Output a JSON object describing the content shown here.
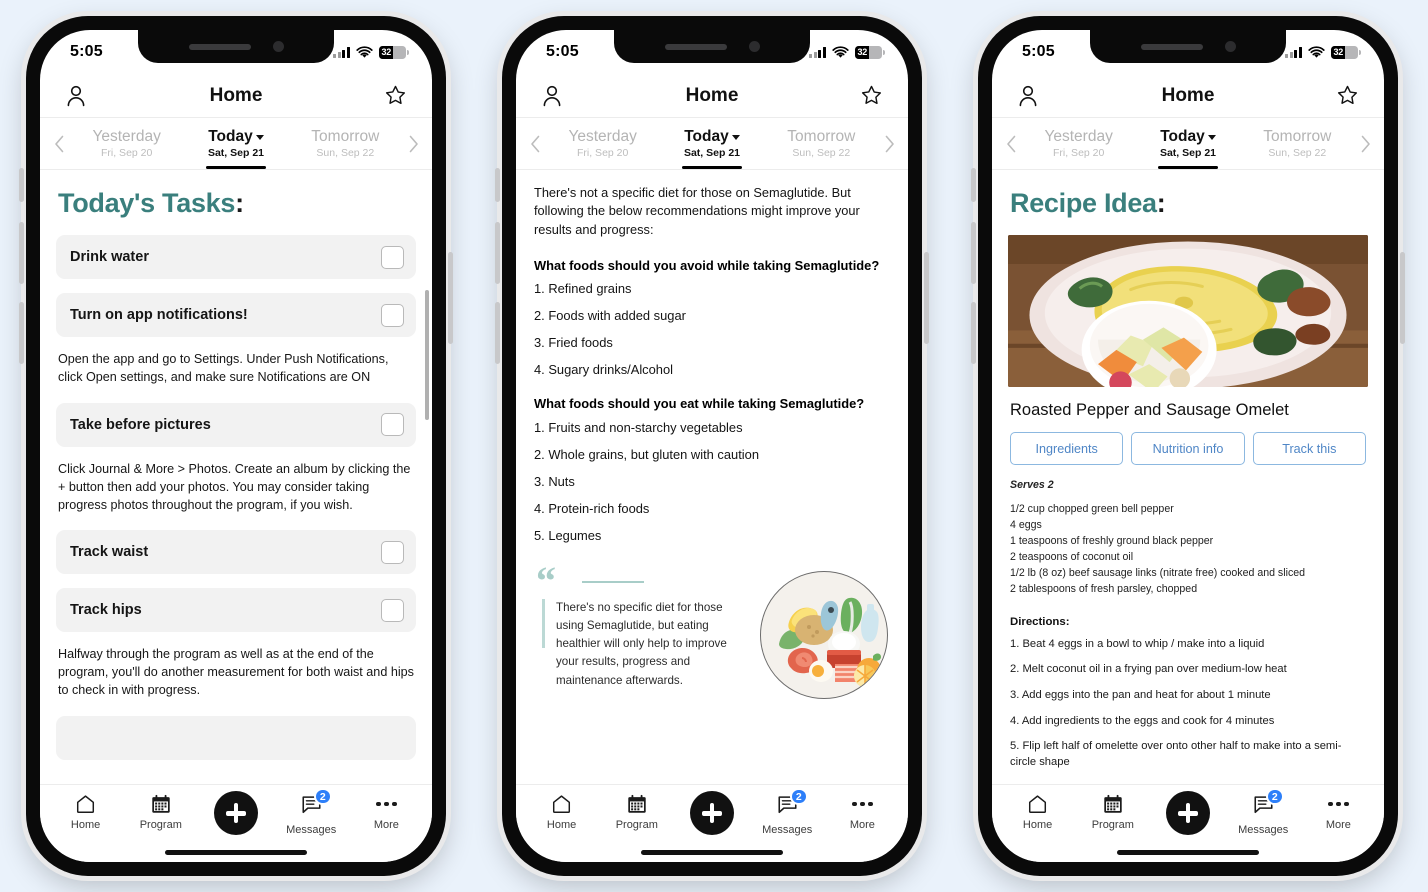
{
  "theme": {
    "accent_teal": "#3a7f7d",
    "pill_blue": "#4f86c6",
    "badge_blue": "#2d7ff9",
    "page_background": "#eaf2fb"
  },
  "status_bar": {
    "time": "5:05",
    "battery_percent": "32",
    "wifi_icon": "wifi-icon",
    "cellular_icon": "cellular-signal-icon"
  },
  "app_bar": {
    "title": "Home",
    "profile_icon": "person-icon",
    "favorite_icon": "star-outline-icon"
  },
  "date_strip": {
    "prev_icon": "chevron-left-icon",
    "next_icon": "chevron-right-icon",
    "days": [
      {
        "label": "Yesterday",
        "date": "Fri, Sep 20",
        "active": false
      },
      {
        "label": "Today",
        "date": "Sat, Sep 21",
        "active": true
      },
      {
        "label": "Tomorrow",
        "date": "Sun, Sep 22",
        "active": false
      }
    ]
  },
  "tab_bar": {
    "home": "Home",
    "program": "Program",
    "add": "add-button",
    "messages": "Messages",
    "messages_badge": "2",
    "more": "More"
  },
  "phone1": {
    "heading": "Today's Tasks",
    "heading_colon": ":",
    "tasks": [
      {
        "label": "Drink water",
        "checked": false,
        "note": null
      },
      {
        "label": "Turn on app notifications!",
        "checked": false,
        "note": "Open the app and go to Settings. Under Push Notifications, click Open settings, and make sure Notifications are ON"
      },
      {
        "label": "Take before pictures",
        "checked": false,
        "note": "Click Journal & More > Photos. Create an album by clicking the + button then add your photos. You may consider taking progress photos throughout the program, if you wish."
      },
      {
        "label": "Track waist",
        "checked": false,
        "note": null
      },
      {
        "label": "Track hips",
        "checked": false,
        "note": "Halfway through the program as well as at the end of the program, you'll do another measurement for both waist and hips to check in with progress."
      }
    ]
  },
  "phone2": {
    "intro": "There's not a specific diet for those on Semaglutide. But following the below recommendations might improve your results and progress:",
    "avoid_heading": "What foods should you avoid while taking Semaglutide?",
    "avoid_items": [
      "1. Refined grains",
      "2. Foods with added sugar",
      "3. Fried foods",
      "4. Sugary drinks/Alcohol"
    ],
    "eat_heading": "What foods should you eat while taking Semaglutide?",
    "eat_items": [
      "1. Fruits and non-starchy vegetables",
      "2. Whole grains, but gluten with caution",
      "3. Nuts",
      "4. Protein-rich foods",
      "5. Legumes"
    ],
    "quote": "There's no specific diet for those using Semaglutide, but eating healthier will only help to improve your results, progress and maintenance afterwards.",
    "quote_mark": "“",
    "illustration": "healthy-food-circle-illustration"
  },
  "phone3": {
    "heading": "Recipe Idea",
    "heading_colon": ":",
    "photo": "omelet-photo",
    "recipe_title": "Roasted Pepper and Sausage Omelet",
    "buttons": [
      "Ingredients",
      "Nutrition info",
      "Track this"
    ],
    "serves": "Serves 2",
    "ingredients": [
      "1/2 cup chopped green bell pepper",
      "4 eggs",
      "1 teaspoons of freshly ground black pepper",
      "2 teaspoons of coconut oil",
      "1/2 lb (8 oz) beef sausage links (nitrate free) cooked and sliced",
      "2 tablespoons of fresh parsley, chopped"
    ],
    "directions_heading": "Directions:",
    "directions": [
      "1. Beat 4 eggs in a bowl to whip / make into a liquid",
      "2. Melt coconut oil in a frying pan over medium-low heat",
      "3. Add eggs into the pan and heat for about 1 minute",
      "4. Add ingredients to the eggs and cook for 4 minutes",
      "5. Flip left half of omelette over onto other half to make into a semi-circle shape"
    ]
  }
}
